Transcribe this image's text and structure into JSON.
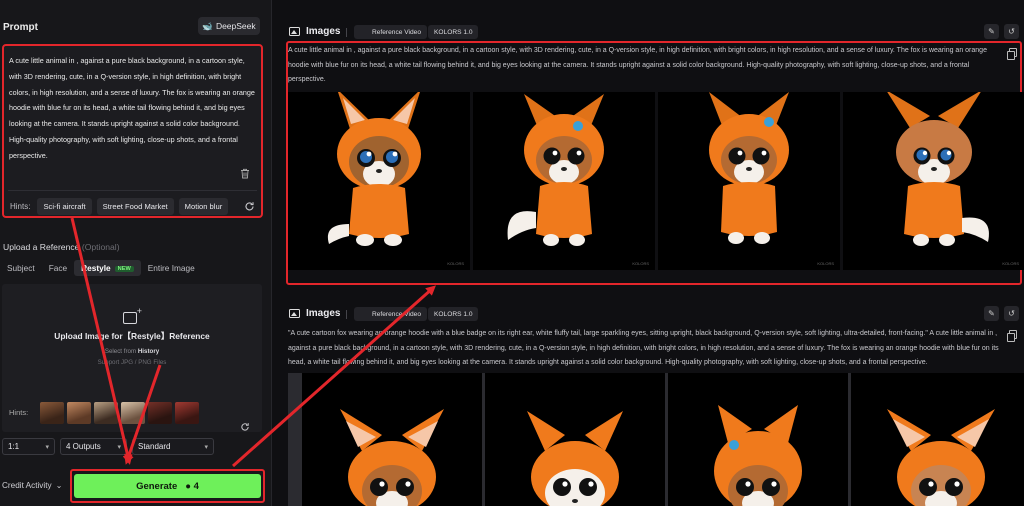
{
  "left": {
    "prompt_title": "Prompt",
    "deepseek_label": "DeepSeek",
    "prompt_text": "A cute little animal in , against a pure black background, in a cartoon style, with 3D rendering, cute, in a Q-version style, in high definition, with bright colors, in high resolution, and a sense of luxury. The fox is wearing an orange hoodie with blue fur on its head, a white tail flowing behind it, and big eyes looking at the camera. It stands upright against a solid color background. High-quality photography, with soft lighting, close-up shots, and a frontal perspective.",
    "hints_label": "Hints:",
    "hints": [
      "Sci-fi aircraft",
      "Street Food Market",
      "Motion blur"
    ],
    "reference_title": "Upload a Reference",
    "reference_optional": "(Optional)",
    "reference_tabs": [
      "Subject",
      "Face",
      "Restyle",
      "Entire Image"
    ],
    "new_badge": "NEW",
    "upload_title": "Upload Image for【Restyle】Reference",
    "upload_select_prefix": "Select from",
    "upload_select_link": "History",
    "upload_formats": "Support JPG / PNG Files",
    "thumbs_hints_label": "Hints:",
    "ratio": "1:1",
    "outputs": "4 Outputs",
    "mode": "Standard",
    "credit_label": "Credit Activity",
    "generate_label": "Generate",
    "generate_cost": "4"
  },
  "right": {
    "section1": {
      "title": "Images",
      "tag1": "Reference Video",
      "tag2": "KOLORS 1.0",
      "text": "A cute little animal in , against a pure black background, in a cartoon style, with 3D rendering, cute, in a Q-version style, in high definition, with bright colors, in high resolution, and a sense of luxury. The fox is wearing an orange hoodie with blue fur on its head, a white tail flowing behind it, and big eyes looking at the camera. It stands upright against a solid color background. High-quality photography, with soft lighting, close-up shots, and a frontal perspective."
    },
    "section2": {
      "title": "Images",
      "tag1": "Reference Video",
      "tag2": "KOLORS 1.0",
      "text": "\"A cute cartoon fox wearing an orange hoodie with a blue badge on its right ear, white fluffy tail, large sparkling eyes, sitting upright, black background, Q-version style, soft lighting, ultra-detailed, front-facing.\" A cute little animal in , against a pure black background, in a cartoon style, with 3D rendering, cute, in a Q-version style, in high definition, with bright colors, in high resolution, and a sense of luxury. The fox is wearing an orange hoodie with blue fur on its head, a white tail flowing behind it, and big eyes looking at the camera. It stands upright against a solid color background. High-quality photography, with soft lighting, close-up shots, and a frontal perspective."
    },
    "watermark": "KOLORS"
  },
  "colors": {
    "accent_green": "#6ef05a",
    "highlight_red": "#e3262b",
    "hoodie_orange": "#f07a1c"
  }
}
